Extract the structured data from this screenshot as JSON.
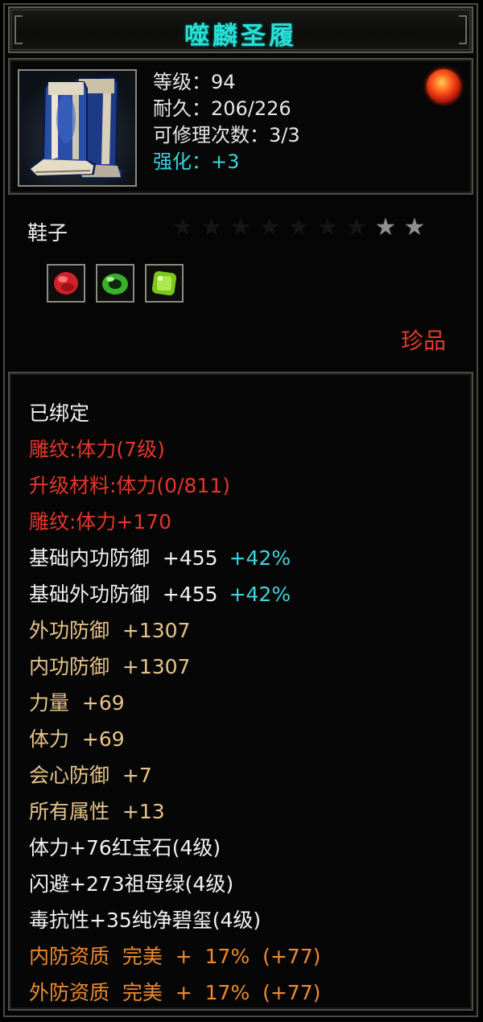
{
  "item": {
    "name": "噬麟圣履",
    "type": "鞋子",
    "rarity": "珍品",
    "icon": "boots-icon",
    "badge_icon": "flame-gem-icon"
  },
  "stats": [
    {
      "label": "等级：94",
      "color": "white"
    },
    {
      "label": "耐久：206/226",
      "color": "white"
    },
    {
      "label": "可修理次数：3/3",
      "color": "white"
    },
    {
      "label": "强化：+3",
      "color": "cyan"
    }
  ],
  "stars": {
    "total": 9,
    "lit": 2
  },
  "sockets": [
    {
      "gem": "ruby",
      "color": "#d0202a"
    },
    {
      "gem": "emerald",
      "color": "#38b02a"
    },
    {
      "gem": "jade",
      "color": "#7cc81a"
    }
  ],
  "attributes": [
    {
      "text": "已绑定",
      "color": "white"
    },
    {
      "text": "雕纹:体力(7级)",
      "color": "red"
    },
    {
      "text": "升级材料:体力(0/811)",
      "color": "red"
    },
    {
      "text": "雕纹:体力+170",
      "color": "red"
    },
    {
      "text": "基础内功防御  +455",
      "extra": "+42%",
      "color": "white"
    },
    {
      "text": "基础外功防御  +455",
      "extra": "+42%",
      "color": "white"
    },
    {
      "text": "外功防御  +1307",
      "color": "gold"
    },
    {
      "text": "内功防御  +1307",
      "color": "gold"
    },
    {
      "text": "力量  +69",
      "color": "gold"
    },
    {
      "text": "体力  +69",
      "color": "gold"
    },
    {
      "text": "会心防御  +7",
      "color": "gold"
    },
    {
      "text": "所有属性  +13",
      "color": "gold"
    },
    {
      "text": "体力+76红宝石(4级)",
      "color": "white"
    },
    {
      "text": "闪避+273祖母绿(4级)",
      "color": "white"
    },
    {
      "text": "毒抗性+35纯净碧玺(4级)",
      "color": "white"
    },
    {
      "text": "内防资质  完美  +  17%  (+77)",
      "color": "orange"
    },
    {
      "text": "外防资质  完美  +  17%  (+77)",
      "color": "orange"
    }
  ],
  "colors": {
    "title": "#29e0d6",
    "white": "#f2f2f2",
    "red": "#e3362b",
    "gold": "#e6c48a",
    "orange": "#ee8a2e",
    "cyan": "#3fd4dc"
  }
}
